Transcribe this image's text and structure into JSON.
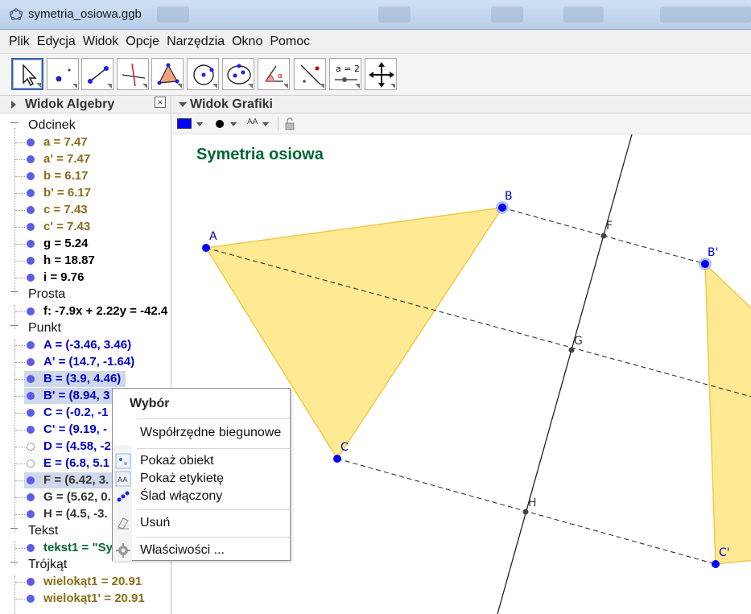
{
  "window": {
    "title": "symetria_osiowa.ggb"
  },
  "menu": [
    "Plik",
    "Edycja",
    "Widok",
    "Opcje",
    "Narzędzia",
    "Okno",
    "Pomoc"
  ],
  "toolbar": {
    "tools": [
      "move-tool",
      "point-tool",
      "segment-tool",
      "perpendicular-line-tool",
      "polygon-tool",
      "circle-tool",
      "ellipse-tool",
      "angle-tool",
      "reflect-tool",
      "slider-tool",
      "move-graphics-tool"
    ],
    "slider_label": "a = 2",
    "angle_label": "α"
  },
  "algebra": {
    "header": "Widok Algebry",
    "categories": {
      "odcinek": "Odcinek",
      "prosta": "Prosta",
      "punkt": "Punkt",
      "tekst": "Tekst",
      "trojkat": "Trójkąt"
    },
    "rows": {
      "a": "a = 7.47",
      "a1": "a' = 7.47",
      "b": "b = 6.17",
      "b1": "b' = 6.17",
      "c": "c = 7.43",
      "c1": "c' = 7.43",
      "g": "g = 5.24",
      "h": "h = 18.87",
      "i": "i = 9.76",
      "f": "f: -7.9x + 2.22y = -42.4",
      "A": "A = (-3.46, 3.46)",
      "A1": "A' = (14.7, -1.64)",
      "B": "B = (3.9, 4.46)",
      "B1": "B' = (8.94, 3",
      "C": "C = (-0.2, -1",
      "C1": "C' = (9.19, -",
      "D": "D = (4.58, -2",
      "E": "E = (6.8, 5.1",
      "F": "F = (6.42, 3.",
      "G": "G = (5.62, 0.",
      "H": "H = (4.5, -3.",
      "tekst1": "tekst1 = \"Sy",
      "w1": "wielokąt1 = 20.91",
      "w2": "wielokąt1' = 20.91"
    },
    "colors": {
      "segment": "#8a6d1a",
      "black": "#000000",
      "point": "#0000cc",
      "text": "#006633"
    }
  },
  "graphics": {
    "header": "Widok Grafiki",
    "style_bar": {
      "label_style": "AA"
    },
    "title": "Symetria osiowa",
    "labels": {
      "A": "A",
      "B": "B",
      "C": "C",
      "B1": "B'",
      "C1": "C'",
      "F": "F",
      "G": "G",
      "H": "H"
    },
    "fill_color": "#ffe57f",
    "point_color": "#0000ff"
  },
  "context_menu": {
    "title": "Wybór",
    "items": {
      "polar": "Współrzędne biegunowe",
      "show_object": "Pokaż obiekt",
      "show_label": "Pokaż etykietę",
      "trace": "Ślad włączony",
      "delete": "Usuń",
      "properties": "Właściwości ..."
    }
  }
}
